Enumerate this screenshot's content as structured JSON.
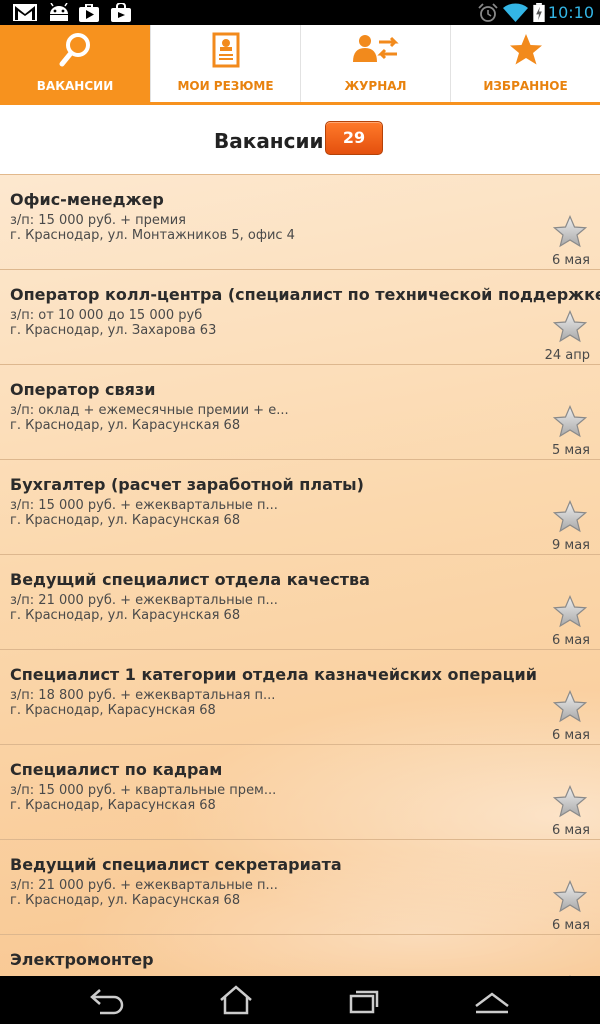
{
  "statusbar": {
    "left_icons": [
      "gmail-icon",
      "android-icon",
      "play-store-icon",
      "shopping-bag-icon"
    ],
    "right_icons": [
      "alarm-icon",
      "wifi-icon",
      "battery-charging-icon"
    ],
    "time": "10:10",
    "accent_color": "#33b5e5"
  },
  "tabs": [
    {
      "label": "ВАКАНСИИ",
      "icon": "search-icon",
      "active": true
    },
    {
      "label": "МОИ РЕЗЮМЕ",
      "icon": "resume-icon",
      "active": false
    },
    {
      "label": "ЖУРНАЛ",
      "icon": "user-exchange-icon",
      "active": false
    },
    {
      "label": "ИЗБРАННОЕ",
      "icon": "star-icon",
      "active": false
    }
  ],
  "header": {
    "title": "Вакансии",
    "count": "29"
  },
  "colors": {
    "brand": "#f7921e",
    "badge": "#f0661a"
  },
  "vacancies": [
    {
      "title": "Офис-менеджер",
      "salary": "з/п: 15 000 руб. + премия",
      "address": "г. Краснодар, ул. Монтажников 5, офис 4",
      "date": "6 мая"
    },
    {
      "title": "Оператор колл-центра (специалист по технической поддержке)",
      "salary": "з/п: от 10 000 до 15 000 руб",
      "address": "г. Краснодар, ул. Захарова 63",
      "date": "24 апр"
    },
    {
      "title": "Оператор связи",
      "salary": "з/п: оклад + ежемесячные премии + е...",
      "address": "г. Краснодар, ул. Карасунская 68",
      "date": "5 мая"
    },
    {
      "title": "Бухгалтер (расчет заработной платы)",
      "salary": "з/п: 15 000 руб. + ежеквартальные п...",
      "address": "г. Краснодар, ул. Карасунская 68",
      "date": "9 мая"
    },
    {
      "title": "Ведущий специалист отдела качества",
      "salary": "з/п: 21 000 руб. + ежеквартальные п...",
      "address": "г. Краснодар, ул. Карасунская 68",
      "date": "6 мая"
    },
    {
      "title": "Специалист 1 категории отдела казначейских операций",
      "salary": "з/п: 18 800 руб. + ежеквартальная п...",
      "address": "г. Краснодар, Карасунская 68",
      "date": "6 мая"
    },
    {
      "title": "Специалист по кадрам",
      "salary": "з/п: 15 000 руб. + квартальные прем...",
      "address": "г. Краснодар, Карасунская 68",
      "date": "6 мая"
    },
    {
      "title": "Ведущий специалист секретариата",
      "salary": "з/п: 21 000 руб. + ежеквартальные п...",
      "address": "г. Краснодар, ул. Карасунская 68",
      "date": "6 мая"
    },
    {
      "title": "Электромонтер",
      "salary": "",
      "address": "",
      "date": ""
    }
  ],
  "navbar": {
    "icons": [
      "back-icon",
      "home-icon",
      "recent-apps-icon",
      "menu-icon"
    ]
  }
}
